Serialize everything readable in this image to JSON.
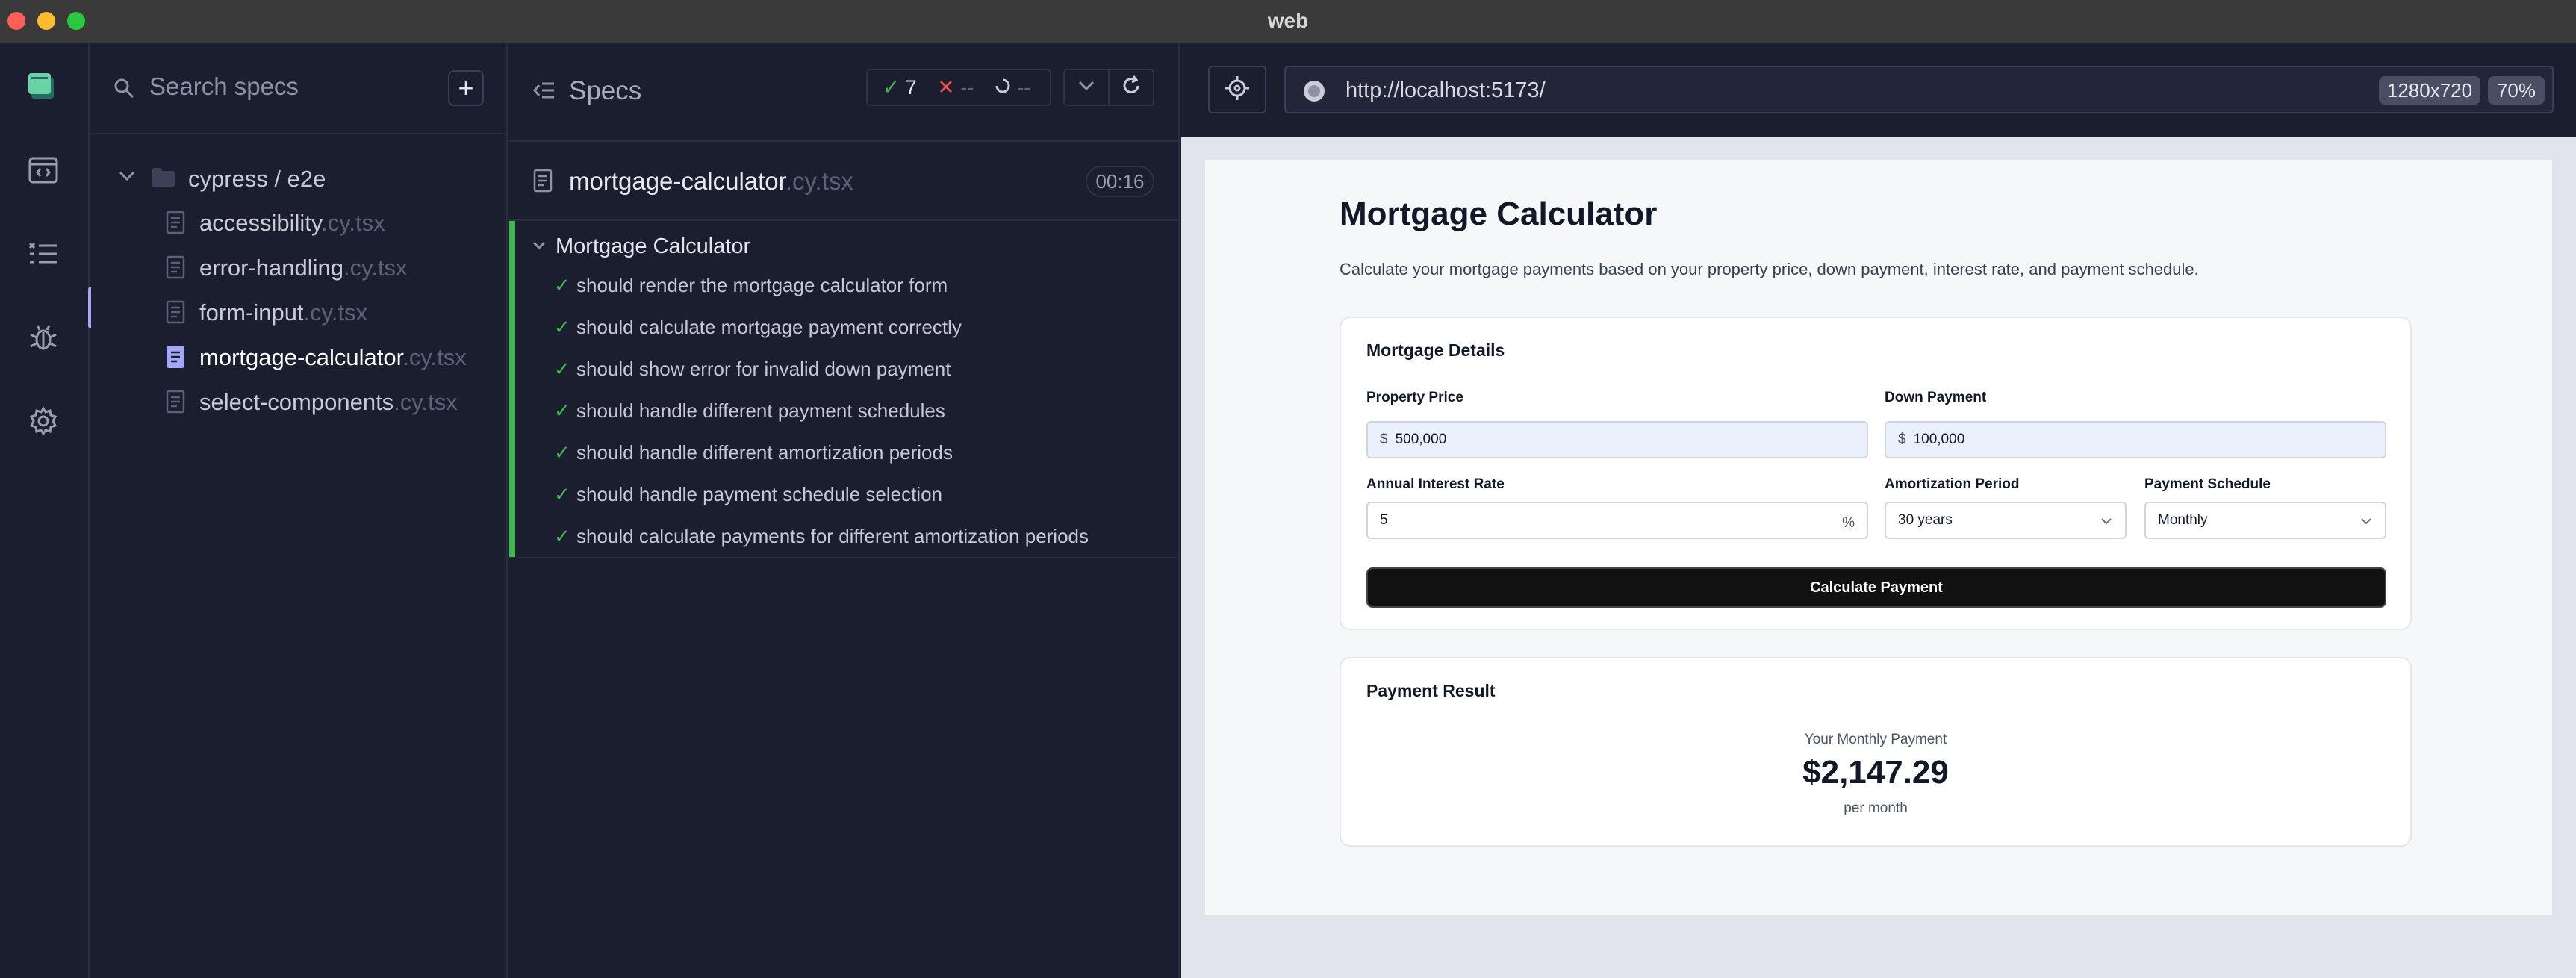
{
  "window": {
    "title": "web"
  },
  "sidebar": {
    "search_placeholder": "Search specs",
    "add_label": "+",
    "folder": "cypress / e2e",
    "files": [
      {
        "name": "accessibility",
        "ext": ".cy.tsx"
      },
      {
        "name": "error-handling",
        "ext": ".cy.tsx"
      },
      {
        "name": "form-input",
        "ext": ".cy.tsx"
      },
      {
        "name": "mortgage-calculator",
        "ext": ".cy.tsx"
      },
      {
        "name": "select-components",
        "ext": ".cy.tsx"
      }
    ],
    "active_file": "mortgage-calculator"
  },
  "runner": {
    "specs_label": "Specs",
    "passed": "7",
    "failed": "--",
    "pending": "--",
    "spec_name": "mortgage-calculator",
    "spec_ext": ".cy.tsx",
    "duration": "00:16",
    "suite_title": "Mortgage Calculator",
    "tests": [
      "should render the mortgage calculator form",
      "should calculate mortgage payment correctly",
      "should show error for invalid down payment",
      "should handle different payment schedules",
      "should handle different amortization periods",
      "should handle payment schedule selection",
      "should calculate payments for different amortization periods"
    ]
  },
  "preview": {
    "url": "http://localhost:5173/",
    "viewport_size": "1280x720",
    "zoom": "70%"
  },
  "app": {
    "title": "Mortgage Calculator",
    "subtitle": "Calculate your mortgage payments based on your property price, down payment, interest rate, and payment schedule.",
    "details_title": "Mortgage Details",
    "property_price_label": "Property Price",
    "property_price_currency": "$",
    "property_price_value": "500,000",
    "down_payment_label": "Down Payment",
    "down_payment_currency": "$",
    "down_payment_value": "100,000",
    "interest_label": "Annual Interest Rate",
    "interest_value": "5",
    "interest_suffix": "%",
    "amortization_label": "Amortization Period",
    "amortization_value": "30 years",
    "schedule_label": "Payment Schedule",
    "schedule_value": "Monthly",
    "calculate_label": "Calculate Payment",
    "result_title": "Payment Result",
    "result_caption": "Your Monthly Payment",
    "result_amount": "$2,147.29",
    "result_unit": "per month"
  },
  "colors": {
    "pass": "#3fb950",
    "fail": "#f85149",
    "accent": "#a3a7f5"
  }
}
